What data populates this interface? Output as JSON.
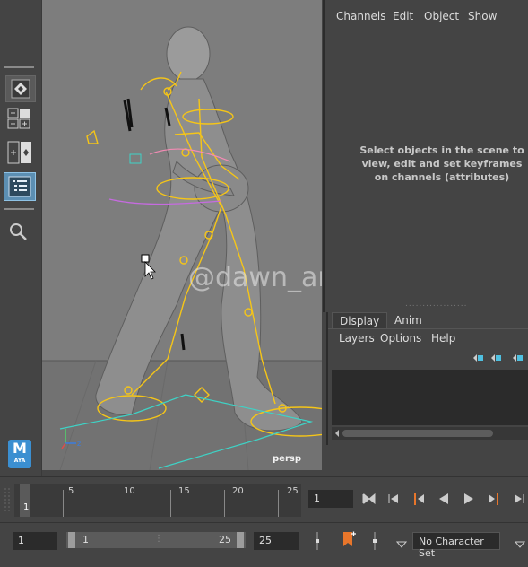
{
  "viewport": {
    "camera_label": "persp",
    "watermark": "@dawn_arc"
  },
  "channel_box": {
    "menu": [
      "Channels",
      "Edit",
      "Object",
      "Show"
    ],
    "message": "Select objects in the scene to view, edit and set keyframes on channels (attributes)"
  },
  "layer_editor": {
    "tabs": [
      "Display",
      "Anim"
    ],
    "menu": [
      "Layers",
      "Options",
      "Help"
    ]
  },
  "logo": {
    "letter": "M",
    "text": "AYA"
  },
  "time_slider": {
    "ticks": [
      "5",
      "10",
      "15",
      "20",
      "25"
    ],
    "current_frame_marker": "1",
    "current_frame_field": "1"
  },
  "range_slider": {
    "start_field": "1",
    "range_start": "1",
    "range_end": "25",
    "end_field": "25",
    "character_set": "No Character Set"
  },
  "colors": {
    "viewport_bg": "#7d7d7d",
    "rig_yellow": "#f5c518",
    "keyframe_orange": "#e8762b",
    "logo_blue": "#3b8fd1",
    "panel_bg": "#444444"
  }
}
